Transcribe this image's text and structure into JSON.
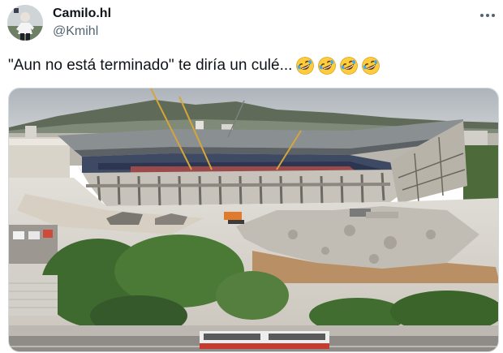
{
  "author": {
    "name": "Camilo.hl",
    "handle": "@Kmihl",
    "avatar_icon": "avatar-football-player-photo"
  },
  "menu": {
    "more_icon": "more-horizontal-icon"
  },
  "tweet": {
    "text": "\"Aun no está terminado\" te diría un culé...",
    "emojis": [
      "rolling-on-floor-laughing",
      "rolling-on-floor-laughing",
      "rolling-on-floor-laughing",
      "rolling-on-floor-laughing"
    ]
  },
  "media": {
    "description_icon": "stadium-under-construction-photo"
  },
  "colors": {
    "text_primary": "#0f1419",
    "text_secondary": "#536471",
    "border": "#cfd9de"
  }
}
